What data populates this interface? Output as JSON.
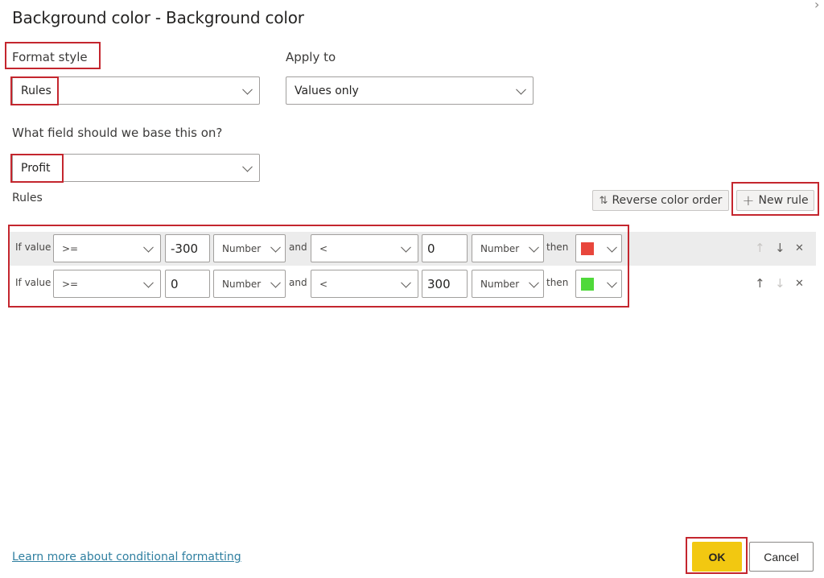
{
  "dialog": {
    "title": "Background color - Background color",
    "close_icon": "close-icon"
  },
  "format_style": {
    "label": "Format style",
    "value": "Rules"
  },
  "apply_to": {
    "label": "Apply to",
    "value": "Values only"
  },
  "base_field": {
    "label": "What field should we base this on?",
    "value": "Profit"
  },
  "rules_section": {
    "label": "Rules",
    "reverse_button": {
      "icon": "sort-arrows-icon",
      "icon_glyph": "⇅",
      "label": "Reverse color order"
    },
    "new_rule_button": {
      "icon": "plus-icon",
      "icon_glyph": "+",
      "label": "New rule"
    }
  },
  "rules": [
    {
      "if_label": "If value",
      "operator1": ">=",
      "value1": "-300",
      "type1": "Number",
      "and_label": "and",
      "operator2": "<",
      "value2": "0",
      "type2": "Number",
      "then_label": "then",
      "color": "#e8463c",
      "actions": {
        "up": "↑",
        "down": "↓",
        "delete": "✕"
      }
    },
    {
      "if_label": "If value",
      "operator1": ">=",
      "value1": "0",
      "type1": "Number",
      "and_label": "and",
      "operator2": "<",
      "value2": "300",
      "type2": "Number",
      "then_label": "then",
      "color": "#4fd93a",
      "actions": {
        "up": "↑",
        "down": "↓",
        "delete": "✕"
      }
    }
  ],
  "footer": {
    "learn_more_link": "Learn more about conditional formatting",
    "ok_label": "OK",
    "cancel_label": "Cancel"
  },
  "colors": {
    "highlight": "#c4262e",
    "ok_button": "#f2c811",
    "link": "#2f7fa0"
  }
}
